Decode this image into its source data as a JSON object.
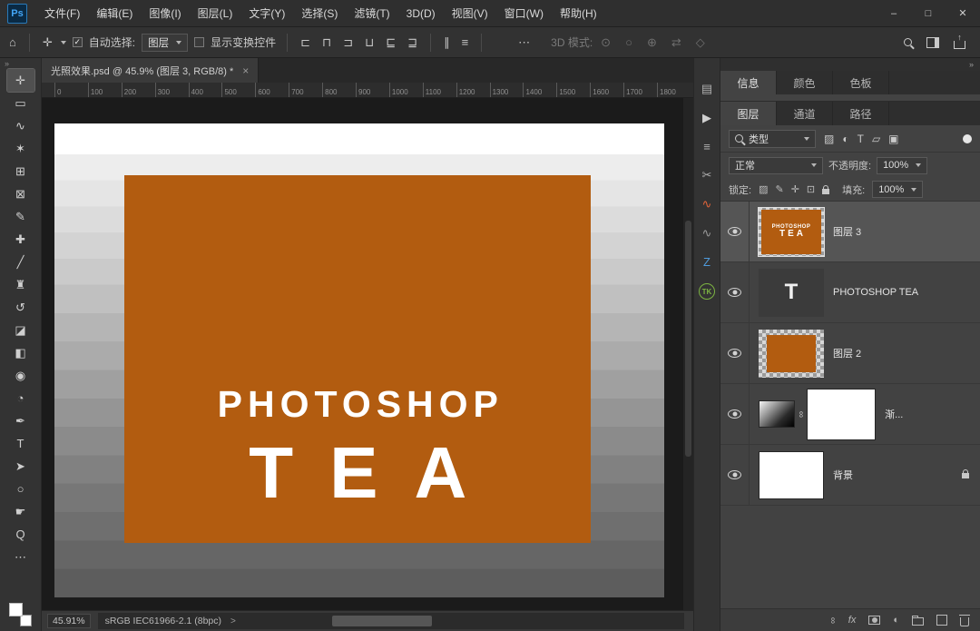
{
  "app": {
    "logo": "Ps"
  },
  "menubar": {
    "items": [
      "文件(F)",
      "编辑(E)",
      "图像(I)",
      "图层(L)",
      "文字(Y)",
      "选择(S)",
      "滤镜(T)",
      "3D(D)",
      "视图(V)",
      "窗口(W)",
      "帮助(H)"
    ]
  },
  "window_controls": {
    "minimize": "–",
    "maximize": "□",
    "close": "✕"
  },
  "optionsbar": {
    "home_glyph": "⌂",
    "move_glyph": "✛",
    "auto_select_label": "自动选择:",
    "auto_select_value": "图层",
    "show_transform_label": "显示变换控件",
    "align_icons": [
      {
        "name": "align-left-icon",
        "glyph": "⊏"
      },
      {
        "name": "align-center-horizontal-icon",
        "glyph": "⊓"
      },
      {
        "name": "align-right-icon",
        "glyph": "⊐"
      },
      {
        "name": "align-top-icon",
        "glyph": "⊔"
      },
      {
        "name": "align-center-vertical-icon",
        "glyph": "⊑"
      },
      {
        "name": "align-bottom-icon",
        "glyph": "⊒"
      }
    ],
    "distribute_icons": [
      {
        "name": "distribute-horizontal-icon",
        "glyph": "∥"
      },
      {
        "name": "distribute-vertical-icon",
        "glyph": "≡"
      }
    ],
    "more_options_glyph": "⋯",
    "mode_3d_label": "3D 模式:",
    "mode_3d_icons": [
      {
        "name": "3d-orbit-icon",
        "glyph": "⊙"
      },
      {
        "name": "3d-roll-icon",
        "glyph": "○"
      },
      {
        "name": "3d-pan-icon",
        "glyph": "⊕"
      },
      {
        "name": "3d-slide-icon",
        "glyph": "⇄"
      },
      {
        "name": "3d-scale-icon",
        "glyph": "◇"
      }
    ]
  },
  "toolbar": {
    "collapse_glyph": "»",
    "tools": [
      {
        "name": "move-tool",
        "glyph": "✛",
        "selected": true
      },
      {
        "name": "rectangular-marquee-tool",
        "glyph": "▭"
      },
      {
        "name": "lasso-tool",
        "glyph": "∿"
      },
      {
        "name": "quick-selection-tool",
        "glyph": "✶"
      },
      {
        "name": "crop-tool",
        "glyph": "⊞"
      },
      {
        "name": "frame-tool",
        "glyph": "⊠"
      },
      {
        "name": "eyedropper-tool",
        "glyph": "✎"
      },
      {
        "name": "healing-brush-tool",
        "glyph": "✚"
      },
      {
        "name": "brush-tool",
        "glyph": "╱"
      },
      {
        "name": "clone-stamp-tool",
        "glyph": "♜"
      },
      {
        "name": "history-brush-tool",
        "glyph": "↺"
      },
      {
        "name": "eraser-tool",
        "glyph": "◪"
      },
      {
        "name": "gradient-tool",
        "glyph": "◧"
      },
      {
        "name": "blur-tool",
        "glyph": "◉"
      },
      {
        "name": "dodge-tool",
        "glyph": "◔"
      },
      {
        "name": "pen-tool",
        "glyph": "✒"
      },
      {
        "name": "type-tool",
        "glyph": "T"
      },
      {
        "name": "path-selection-tool",
        "glyph": "➤"
      },
      {
        "name": "shape-tool",
        "glyph": "○"
      },
      {
        "name": "hand-tool",
        "glyph": "☛"
      },
      {
        "name": "zoom-tool",
        "glyph": "Q"
      },
      {
        "name": "edit-toolbar-button",
        "glyph": "⋯"
      }
    ]
  },
  "doc_tab": {
    "title": "光照效果.psd @ 45.9% (图层 3, RGB/8) *",
    "close": "×"
  },
  "ruler_ticks": [
    "0",
    "100",
    "200",
    "300",
    "400",
    "500",
    "600",
    "700",
    "800",
    "900",
    "1000",
    "1100",
    "1200",
    "1300",
    "1400",
    "1500",
    "1600",
    "1700",
    "1800"
  ],
  "canvas": {
    "poster_line1": "PHOTOSHOP",
    "poster_line2": "TEA",
    "poster_color": "#b25c10"
  },
  "statusbar": {
    "zoom": "45.91%",
    "doc_info": "sRGB IEC61966-2.1 (8bpc)",
    "chevron": ">"
  },
  "panel_strip": [
    {
      "name": "libraries-panel-icon",
      "glyph": "▤",
      "color": "#b0b0b0"
    },
    {
      "name": "actions-panel-icon",
      "glyph": "▶",
      "color": "#d0d0d0"
    },
    {
      "name": "properties-panel-icon",
      "glyph": "≡",
      "color": "#b0b0b0"
    },
    {
      "name": "tool-presets-panel-icon",
      "glyph": "✂",
      "color": "#b0b0b0"
    },
    {
      "name": "plugin-wave-orange-panel-icon",
      "glyph": "∿",
      "color": "#e0643a"
    },
    {
      "name": "plugin-wave-gray-panel-icon",
      "glyph": "∿",
      "color": "#9a9a9a"
    },
    {
      "name": "plugin-z-panel-icon",
      "glyph": "Z",
      "color": "#4f9bdc"
    },
    {
      "name": "plugin-tk-panel-icon",
      "glyph": "TK",
      "color": "#7cb342",
      "badge": true
    }
  ],
  "panels": {
    "collapse_glyph": "»",
    "group1_tabs": [
      "信息",
      "颜色",
      "色板"
    ],
    "group2_tabs": [
      "图层",
      "通道",
      "路径"
    ],
    "filter": {
      "kind_label": "类型",
      "icons": [
        {
          "name": "filter-pixel-layers-icon",
          "glyph": "▨"
        },
        {
          "name": "filter-adjustment-layers-icon",
          "glyph": "◐"
        },
        {
          "name": "filter-type-layers-icon",
          "glyph": "T"
        },
        {
          "name": "filter-shape-layers-icon",
          "glyph": "▱"
        },
        {
          "name": "filter-smart-objects-icon",
          "glyph": "▣"
        }
      ]
    },
    "blend": {
      "mode": "正常",
      "opacity_label": "不透明度:",
      "opacity_value": "100%"
    },
    "lock": {
      "label": "锁定:",
      "icons": [
        {
          "name": "lock-transparency-icon",
          "glyph": "▨"
        },
        {
          "name": "lock-image-icon",
          "glyph": "✎"
        },
        {
          "name": "lock-position-icon",
          "glyph": "✛"
        },
        {
          "name": "lock-artboard-icon",
          "glyph": "⊡"
        },
        {
          "name": "lock-all-icon",
          "shape": "lock"
        }
      ],
      "fill_label": "填充:",
      "fill_value": "100%"
    },
    "layers": [
      {
        "name": "图层 3",
        "selected": true
      },
      {
        "name": "PHOTOSHOP TEA",
        "thumb_glyph": "T"
      },
      {
        "name": "图层 2"
      },
      {
        "name": "渐...",
        "link_glyph": "∞"
      },
      {
        "name": "背景",
        "locked": true
      }
    ],
    "footer_icons": [
      {
        "name": "link-layers-icon",
        "glyph": "∞",
        "cls": "rot90"
      },
      {
        "name": "layer-style-icon",
        "glyph": "fx",
        "cls": "fx-label"
      },
      {
        "name": "add-layer-mask-icon",
        "css": "mask"
      },
      {
        "name": "new-adjustment-layer-icon",
        "glyph": "◐"
      },
      {
        "name": "new-group-icon",
        "css": "folder"
      },
      {
        "name": "new-layer-icon",
        "css": "new"
      },
      {
        "name": "delete-layer-icon",
        "css": "trash"
      }
    ]
  }
}
